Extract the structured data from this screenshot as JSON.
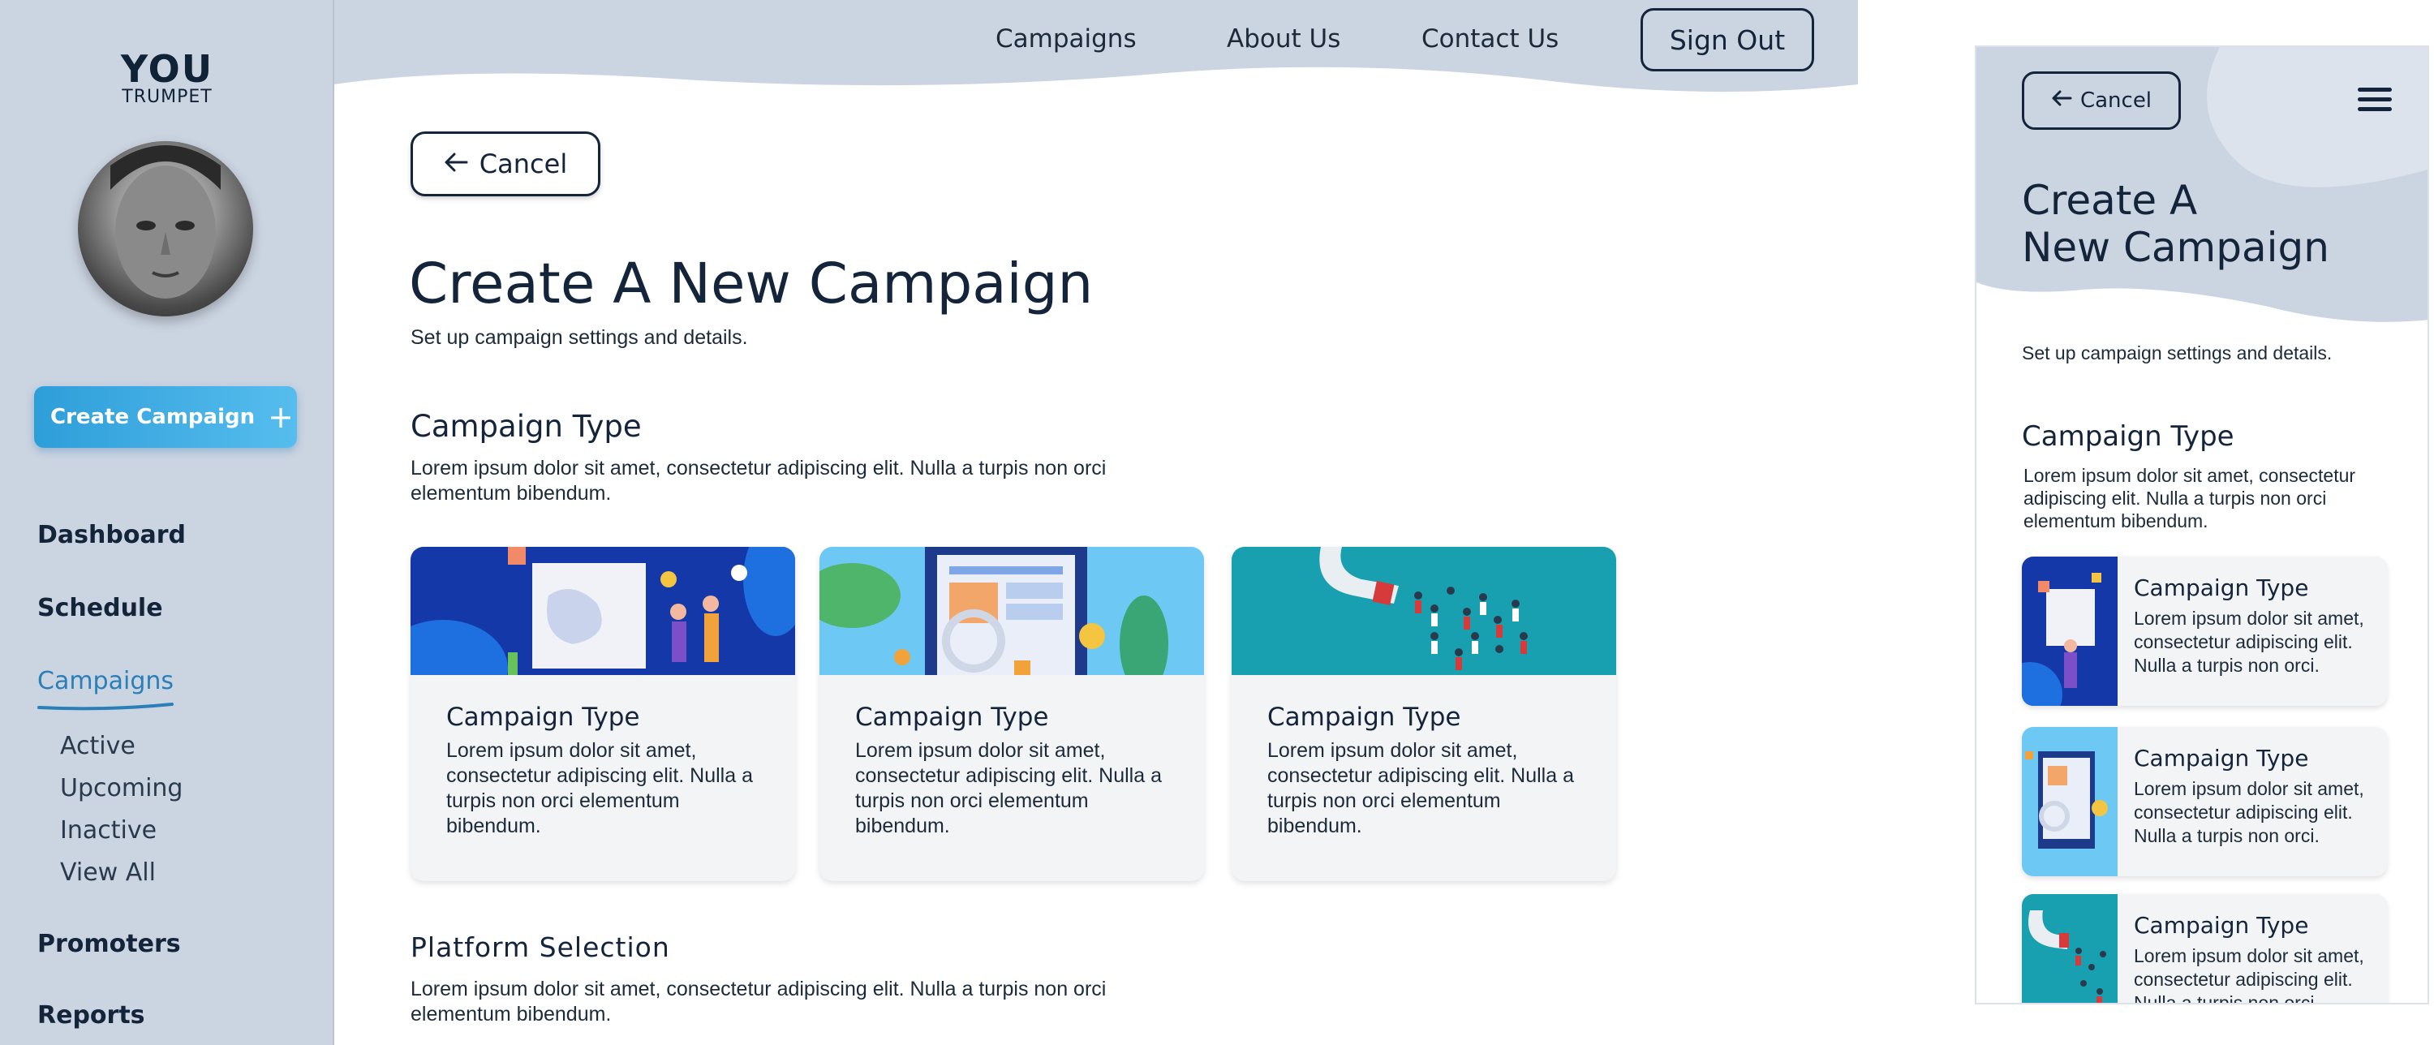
{
  "sidebar": {
    "logo_main": "YOU",
    "logo_sub": "TRUMPET",
    "create_label": "Create Campaign",
    "nav": [
      "Dashboard",
      "Schedule",
      "Campaigns",
      "Promoters",
      "Reports"
    ],
    "sub_items": [
      "Active",
      "Upcoming",
      "Inactive",
      "View All"
    ]
  },
  "header": {
    "links": [
      "Campaigns",
      "About Us",
      "Contact Us"
    ],
    "signout_label": "Sign Out"
  },
  "main": {
    "cancel_label": "Cancel",
    "title": "Create A New Campaign",
    "subtitle": "Set up campaign settings and details.",
    "campaign_section": {
      "title": "Campaign Type",
      "desc": "Lorem ipsum dolor sit amet, consectetur adipiscing elit. Nulla a turpis non orci elementum bibendum."
    },
    "cards": [
      {
        "title": "Campaign Type",
        "desc": "Lorem ipsum dolor sit amet, consectetur adipiscing elit. Nulla a turpis non orci elementum bibendum."
      },
      {
        "title": "Campaign Type",
        "desc": "Lorem ipsum dolor sit amet, consectetur adipiscing elit. Nulla a turpis non orci elementum bibendum."
      },
      {
        "title": "Campaign Type",
        "desc": "Lorem ipsum dolor sit amet, consectetur adipiscing elit. Nulla a turpis non orci elementum bibendum."
      }
    ],
    "platform_section": {
      "title": "Platform Selection",
      "desc": "Lorem ipsum dolor sit amet, consectetur adipiscing elit. Nulla a turpis non orci elementum bibendum."
    }
  },
  "mobile": {
    "cancel_label": "Cancel",
    "title_line1": "Create A",
    "title_line2": "New Campaign",
    "subtitle": "Set up campaign settings and details.",
    "section_title": "Campaign Type",
    "section_desc": "Lorem ipsum dolor sit amet, consectetur adipiscing elit. Nulla a turpis non orci elementum bibendum.",
    "cards": [
      {
        "title": "Campaign Type",
        "desc": "Lorem ipsum dolor sit amet, consectetur adipiscing elit. Nulla a turpis non orci."
      },
      {
        "title": "Campaign Type",
        "desc": "Lorem ipsum dolor sit amet, consectetur adipiscing elit. Nulla a turpis non orci."
      },
      {
        "title": "Campaign Type",
        "desc": "Lorem ipsum dolor sit amet, consectetur adipiscing elit. Nulla a turpis non orci."
      }
    ]
  },
  "colors": {
    "sidebar_bg": "#cbd4e1",
    "accent": "#2e9ed9",
    "text_dark": "#14243a",
    "card_bg": "#f3f4f6"
  }
}
